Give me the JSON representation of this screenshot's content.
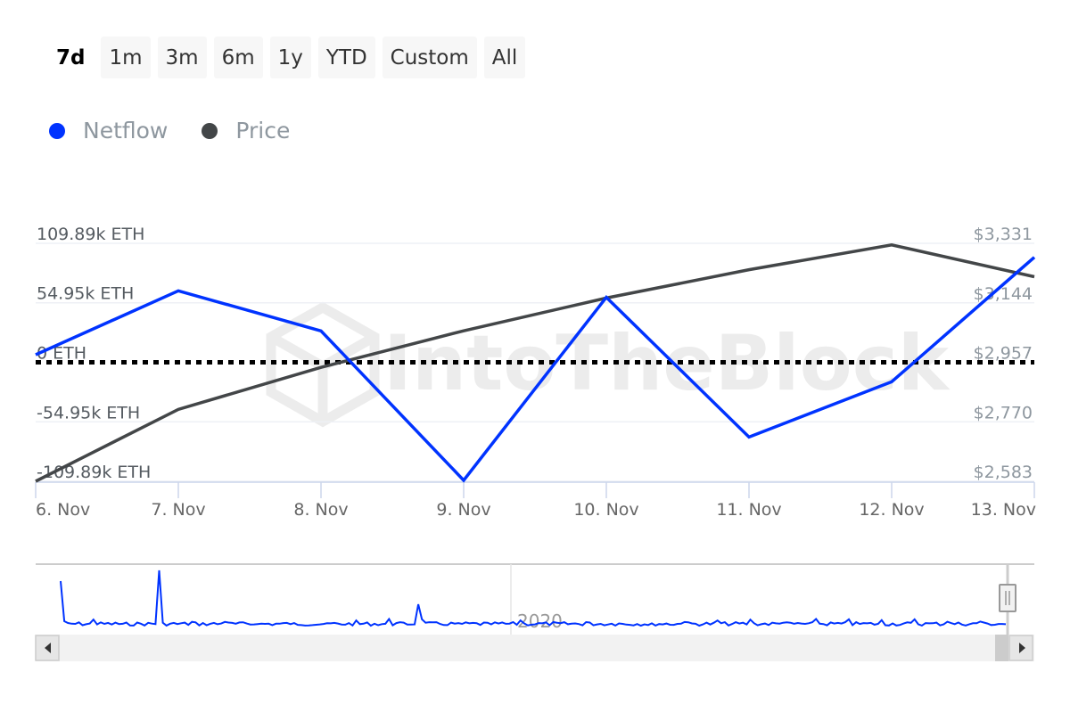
{
  "range_selector": {
    "buttons": [
      {
        "label": "7d",
        "active": true
      },
      {
        "label": "1m",
        "active": false
      },
      {
        "label": "3m",
        "active": false
      },
      {
        "label": "6m",
        "active": false
      },
      {
        "label": "1y",
        "active": false
      },
      {
        "label": "YTD",
        "active": false
      },
      {
        "label": "Custom",
        "active": false
      },
      {
        "label": "All",
        "active": false
      }
    ]
  },
  "colors": {
    "netflow": "#0033ff",
    "price": "#434648",
    "gridline": "#eef0f5",
    "axis": "#ccd6eb",
    "zero_line": "#000000",
    "watermark": "#ececec"
  },
  "watermark": "IntoTheBlock",
  "navigator": {
    "year_label": "2020",
    "scrollbar": {
      "left_arrow": "◀",
      "right_arrow": "▶",
      "handle_glyph": "||"
    }
  },
  "chart_data": {
    "type": "line",
    "title": "",
    "legend": [
      {
        "name": "Netflow",
        "color": "#0033ff"
      },
      {
        "name": "Price",
        "color": "#434648"
      }
    ],
    "legend_position": "top-left",
    "x": [
      "6. Nov",
      "7. Nov",
      "8. Nov",
      "9. Nov",
      "10. Nov",
      "11. Nov",
      "12. Nov",
      "13. Nov"
    ],
    "series": [
      {
        "name": "Netflow",
        "axis": "left",
        "values": [
          7000,
          66000,
          29000,
          -109000,
          60000,
          -69000,
          -18000,
          97000
        ]
      },
      {
        "name": "Price",
        "axis": "right",
        "values": [
          2583,
          2809,
          2941,
          3056,
          3159,
          3248,
          3326,
          3226
        ]
      }
    ],
    "y_left": {
      "label": "",
      "ticks": [
        "109.89k ETH",
        "54.95k ETH",
        "0 ETH",
        "-54.95k ETH",
        "-109.89k ETH"
      ],
      "tick_values": [
        109890,
        54950,
        0,
        -54950,
        -109890
      ],
      "range": [
        -109890,
        109890
      ]
    },
    "y_right": {
      "label": "",
      "ticks": [
        "$3,331",
        "$3,144",
        "$2,957",
        "$2,770",
        "$2,583"
      ],
      "tick_values": [
        3331,
        3144,
        2957,
        2770,
        2583
      ],
      "range": [
        2583,
        3331
      ]
    },
    "zero_line": "dotted",
    "grid": true
  }
}
